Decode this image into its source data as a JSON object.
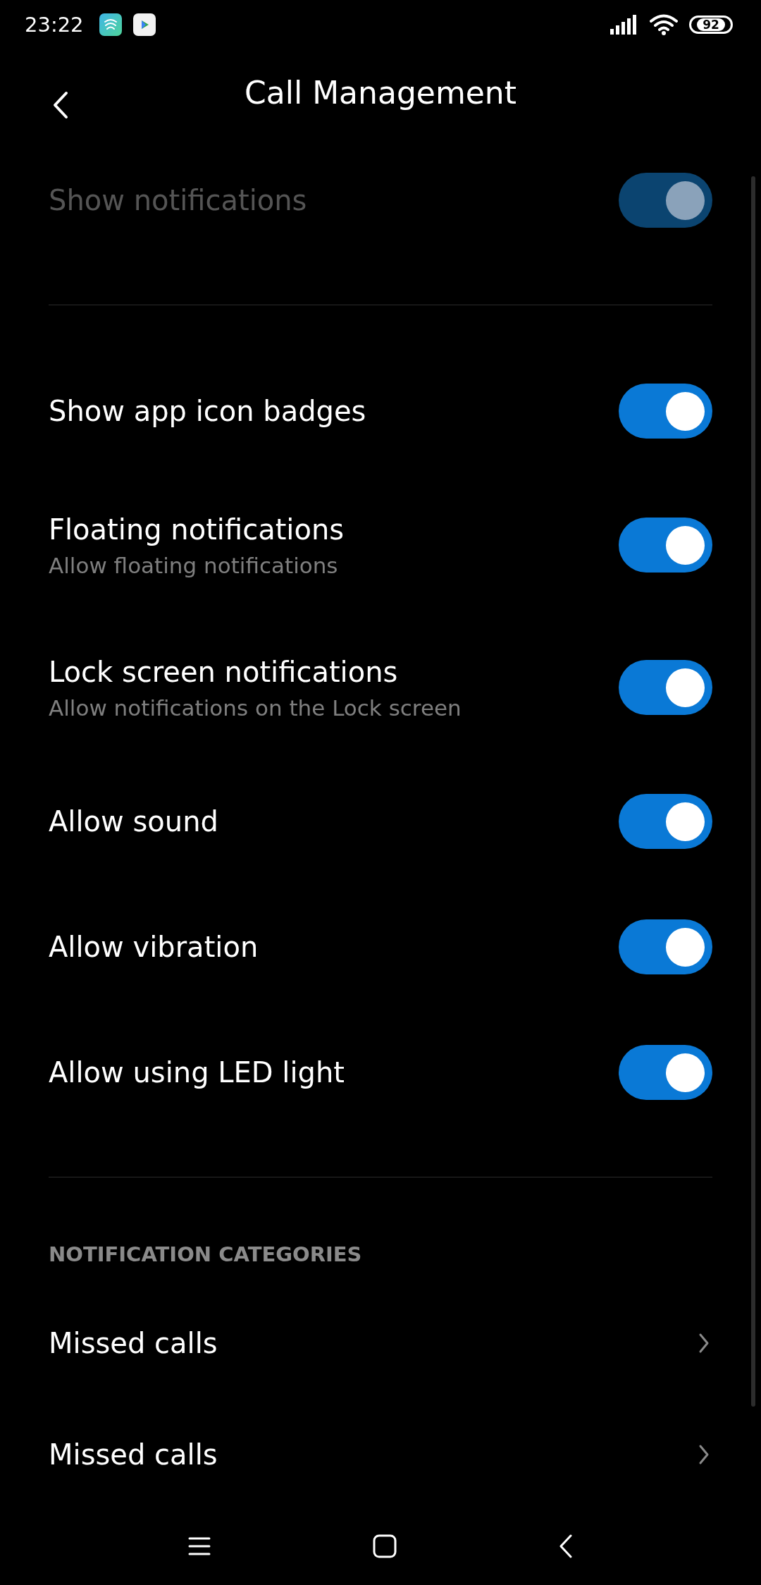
{
  "status_bar": {
    "time": "23:22",
    "battery": "92"
  },
  "header": {
    "title": "Call Management"
  },
  "sections": [
    {
      "items": [
        {
          "kind": "toggle",
          "label": "Show notifications",
          "on": true,
          "disabled": true
        }
      ]
    },
    {
      "items": [
        {
          "kind": "toggle",
          "label": "Show app icon badges",
          "on": true,
          "disabled": false
        },
        {
          "kind": "toggle",
          "label": "Floating notifications",
          "subtitle": "Allow floating notifications",
          "on": true,
          "disabled": false
        },
        {
          "kind": "toggle",
          "label": "Lock screen notifications",
          "subtitle": "Allow notifications on the Lock screen",
          "on": true,
          "disabled": false
        },
        {
          "kind": "toggle",
          "label": "Allow sound",
          "on": true,
          "disabled": false
        },
        {
          "kind": "toggle",
          "label": "Allow vibration",
          "on": true,
          "disabled": false
        },
        {
          "kind": "toggle",
          "label": "Allow using LED light",
          "on": true,
          "disabled": false
        }
      ]
    },
    {
      "title": "NOTIFICATION CATEGORIES",
      "items": [
        {
          "kind": "link",
          "label": "Missed calls"
        },
        {
          "kind": "link",
          "label": "Missed calls"
        }
      ]
    }
  ]
}
